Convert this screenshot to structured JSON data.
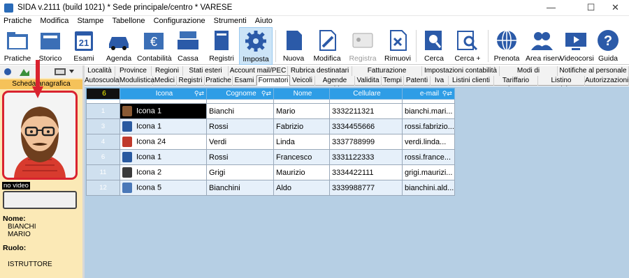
{
  "window": {
    "title": "SIDA v.2111 (build 1021) * Sede principale/centro * VARESE",
    "minimize": "—",
    "maximize": "☐",
    "close": "✕"
  },
  "menu": [
    "Pratiche",
    "Modifica",
    "Stampe",
    "Tabellone",
    "Configurazione",
    "Strumenti",
    "Aiuto"
  ],
  "ribbon": {
    "pratiche": "Pratiche",
    "storico": "Storico",
    "esami": "Esami",
    "esami_day": "21",
    "agenda": "Agenda",
    "contabilita": "Contabilità",
    "cassa": "Cassa",
    "registri": "Registri",
    "imposta": "Imposta",
    "nuova": "Nuova",
    "modifica": "Modifica",
    "registra": "Registra",
    "rimuovi": "Rimuovi",
    "cerca": "Cerca",
    "cerca_plus": "Cerca +",
    "prenota": "Prenota",
    "area_riserv": "Area riserv.",
    "videocorsi": "Videocorsi",
    "guida": "Guida"
  },
  "left_panel": {
    "scheda": "Scheda anagrafica",
    "no_video": "no video",
    "nome_label": "Nome:",
    "nome_1": "BIANCHI",
    "nome_2": "MARIO",
    "ruolo_label": "Ruolo:",
    "ruolo": "ISTRUTTORE"
  },
  "tabs_row1": [
    "Località",
    "Province",
    "Regioni",
    "Stati esteri",
    "Account mail/PEC",
    "Rubrica destinatari",
    "Fatturazione elettronica",
    "Impostazioni contabilità",
    "Modi di pagamento",
    "Notifiche al personale"
  ],
  "tabs_row2": [
    "Autoscuola",
    "Modulistica",
    "Medici",
    "Registri",
    "Pratiche",
    "Esami",
    "Formatori",
    "Veicoli",
    "Agende guida",
    "Validita",
    "Tempi",
    "Patenti",
    "Iva",
    "Listini clienti",
    "Tariffario base",
    "Listino pratiche",
    "Autorizzazioni"
  ],
  "grid": {
    "count": "6",
    "columns": [
      "Icona",
      "Cognome",
      "Nome",
      "Cellulare",
      "e-mail"
    ],
    "rows": [
      {
        "num": "1",
        "icona": "Icona 1",
        "cognome": "Bianchi",
        "nome": "Mario",
        "cellulare": "3332211321",
        "email": "bianchi.mari..."
      },
      {
        "num": "3",
        "icona": "Icona 1",
        "cognome": "Rossi",
        "nome": "Fabrizio",
        "cellulare": "3334455666",
        "email": "rossi.fabrizio..."
      },
      {
        "num": "4",
        "icona": "Icona 24",
        "cognome": "Verdi",
        "nome": "Linda",
        "cellulare": "3337788999",
        "email": "verdi.linda..."
      },
      {
        "num": "6",
        "icona": "Icona 1",
        "cognome": "Rossi",
        "nome": "Francesco",
        "cellulare": "3331122333",
        "email": "rossi.france..."
      },
      {
        "num": "11",
        "icona": "Icona 2",
        "cognome": "Grigi",
        "nome": "Maurizio",
        "cellulare": "3334422111",
        "email": "grigi.maurizi..."
      },
      {
        "num": "12",
        "icona": "Icona 5",
        "cognome": "Bianchini",
        "nome": "Aldo",
        "cellulare": "3339988777",
        "email": "bianchini.ald..."
      }
    ]
  },
  "colors": {
    "accent": "#2e9de6",
    "highlight": "#d9232f",
    "panel": "#fbe9b6"
  }
}
